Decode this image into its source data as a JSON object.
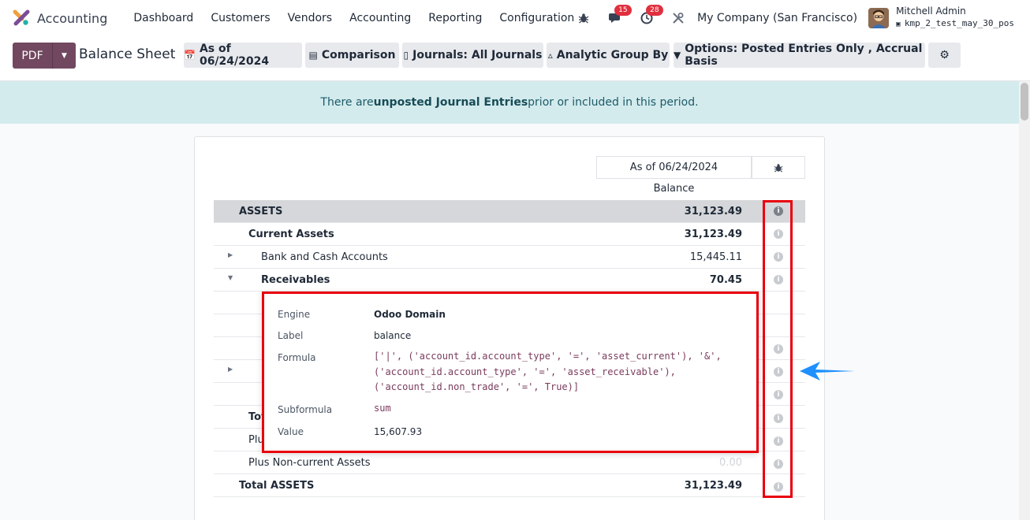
{
  "app": {
    "name": "Accounting"
  },
  "menu": [
    "Dashboard",
    "Customers",
    "Vendors",
    "Accounting",
    "Reporting",
    "Configuration"
  ],
  "nav": {
    "messages_count": "15",
    "activities_count": "28",
    "company": "My Company (San Francisco)",
    "user_name": "Mitchell Admin",
    "database": "kmp_2_test_may_30_pos"
  },
  "toolbar": {
    "pdf_label": "PDF",
    "title": "Balance Sheet",
    "date_filter": "As of 06/24/2024",
    "comparison": "Comparison",
    "journals": "Journals: All Journals",
    "analytic": "Analytic Group By",
    "options": "Options: Posted Entries Only , Accrual Basis"
  },
  "alert": {
    "prefix": "There are ",
    "link": "unposted Journal Entries",
    "suffix": " prior or included in this period."
  },
  "report": {
    "column_date": "As of 06/24/2024",
    "column_label": "Balance",
    "rows": [
      {
        "label": "ASSETS",
        "value": "31,123.49"
      },
      {
        "label": "Current Assets",
        "value": "31,123.49"
      },
      {
        "label": "Bank and Cash Accounts",
        "value": "15,445.11"
      },
      {
        "label": "Receivables",
        "value": "70.45"
      },
      {
        "label": "Tot",
        "value": ""
      },
      {
        "label": "Plu",
        "value": ""
      },
      {
        "label": "Plus Non-current Assets",
        "value": "0.00"
      },
      {
        "label": "Total ASSETS",
        "value": "31,123.49"
      }
    ]
  },
  "tooltip": {
    "engine_key": "Engine",
    "engine_val": "Odoo Domain",
    "label_key": "Label",
    "label_val": "balance",
    "formula_key": "Formula",
    "formula_line1": "['|', ('account_id.account_type', '=', 'asset_current'), '&',",
    "formula_line2": "('account_id.account_type', '=', 'asset_receivable'),",
    "formula_line3": "('account_id.non_trade', '=', True)]",
    "subformula_key": "Subformula",
    "subformula_val": "sum",
    "value_key": "Value",
    "value_val": "15,607.93"
  },
  "colors": {
    "brand": "#71485f",
    "alert_bg": "#d4ebee",
    "highlight": "#e8000b",
    "arrow": "#1e90ff"
  }
}
